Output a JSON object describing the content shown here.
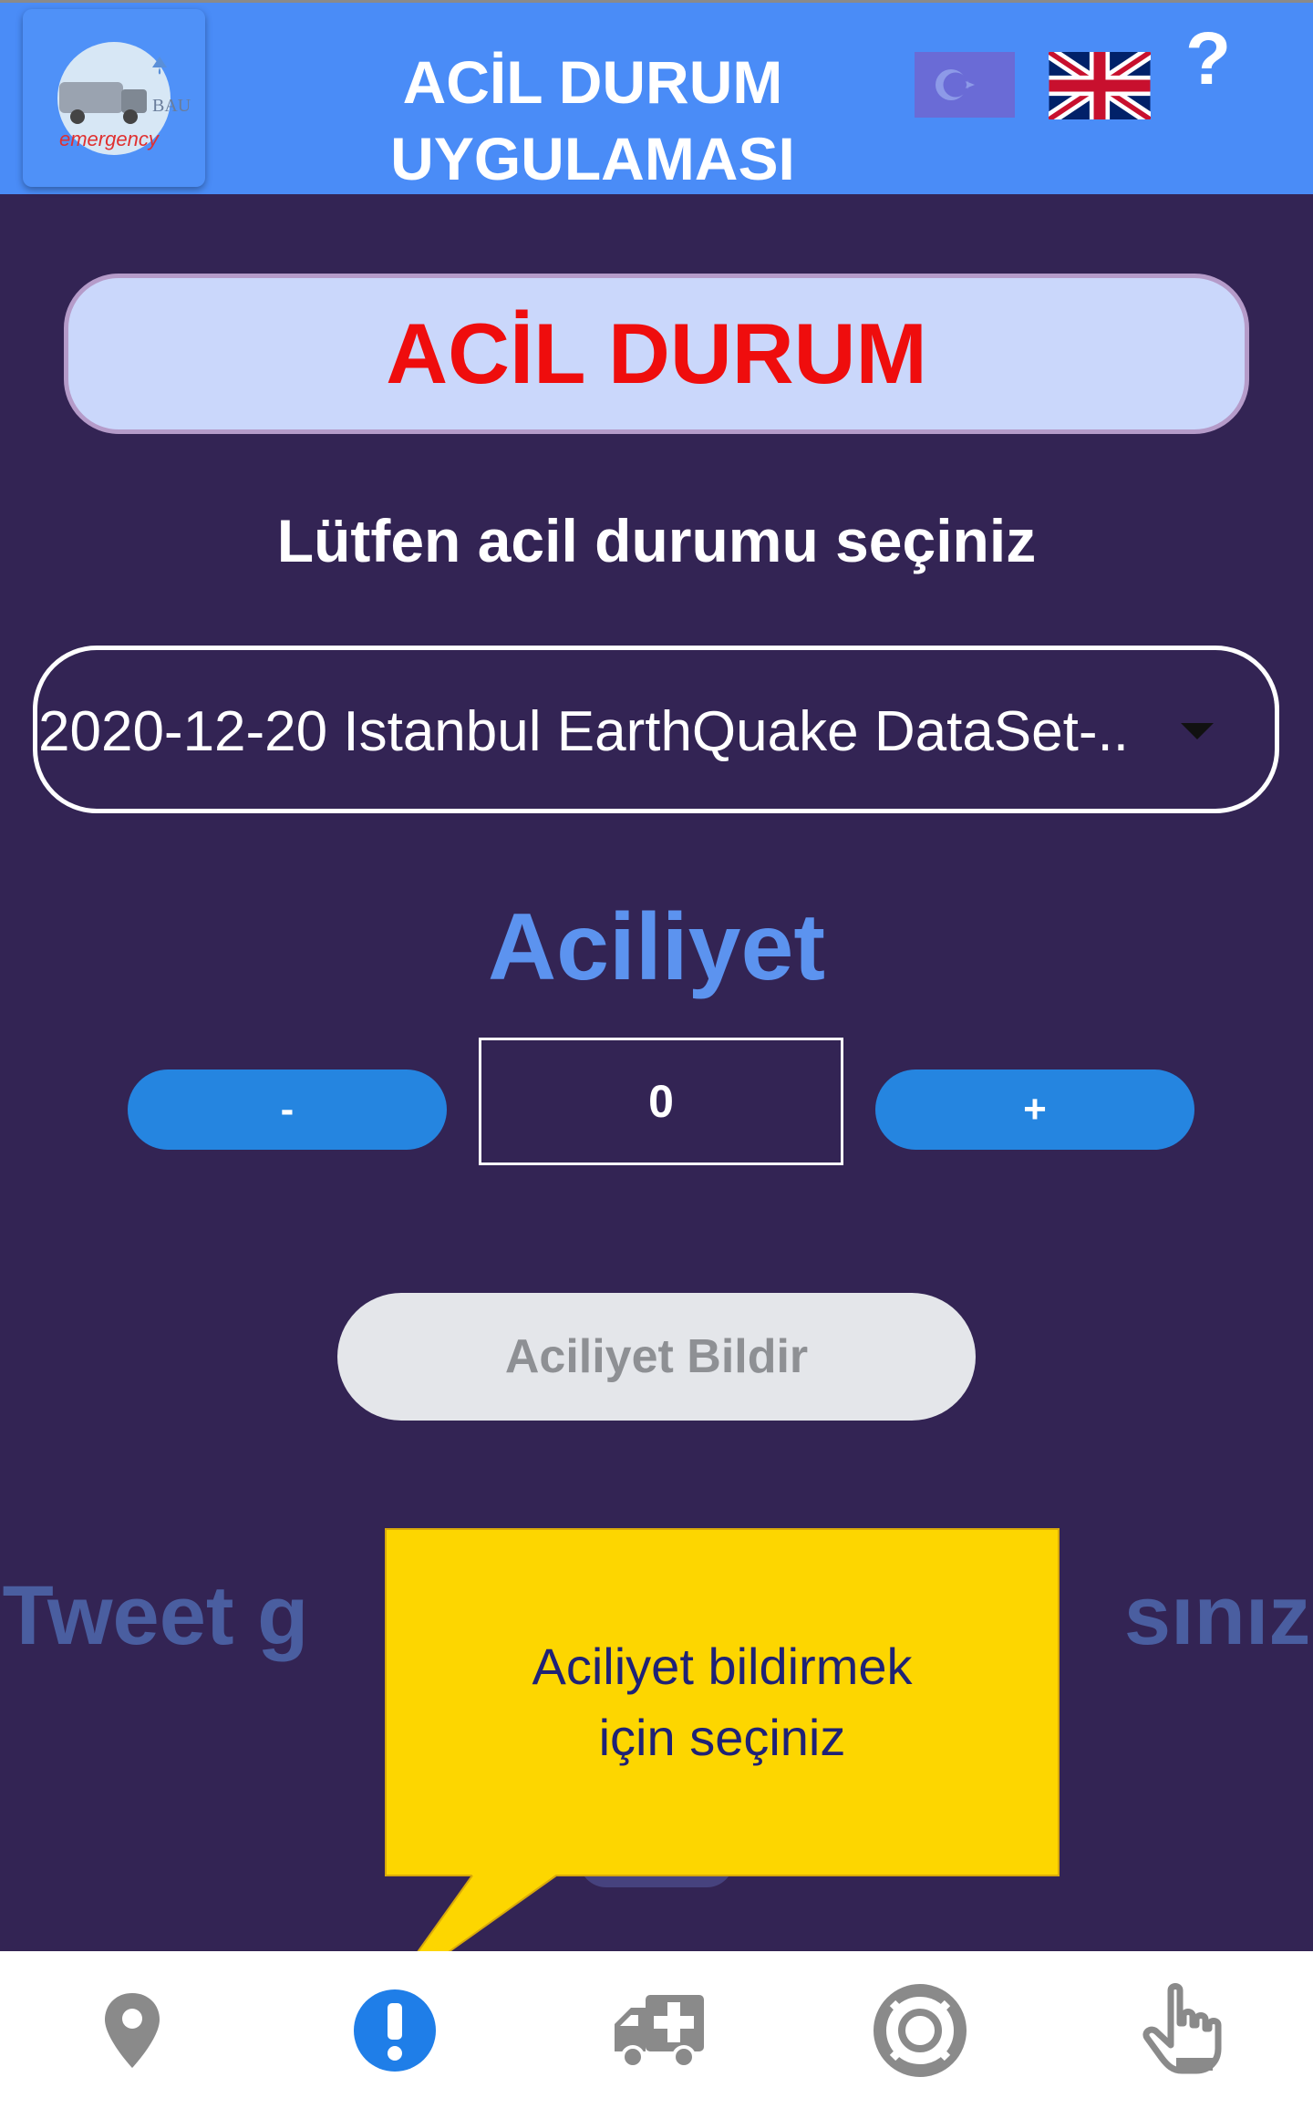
{
  "header": {
    "title_line1": "ACİL DURUM",
    "title_line2": "UYGULAMASI",
    "logo_text_small": "BAU",
    "logo_text": "emergency",
    "help_label": "?"
  },
  "main": {
    "emergency_button_label": "ACİL DURUM",
    "select_prompt": "Lütfen acil durumu seçiniz",
    "selected_dataset": "2020-12-20 Istanbul EarthQuake DataSet-..",
    "urgency_title": "Aciliyet",
    "decrement_label": "-",
    "urgency_value": "0",
    "increment_label": "+",
    "report_button_label": "Aciliyet Bildir",
    "tweet_text_visible": "Tweet g                                   sınız"
  },
  "callout": {
    "line1": "Aciliyet bildirmek",
    "line2": "için seçiniz"
  },
  "bottom_nav": {
    "items": [
      {
        "icon": "location-pin-icon"
      },
      {
        "icon": "exclamation-icon",
        "active": true
      },
      {
        "icon": "ambulance-icon"
      },
      {
        "icon": "lifebuoy-icon"
      },
      {
        "icon": "hand-pointer-icon"
      }
    ]
  },
  "colors": {
    "header_bg": "#4a8cf7",
    "page_bg": "#332454",
    "emergency_text": "#ef0d0d",
    "accent_button": "#2585e0",
    "callout_bg": "#fdd600",
    "nav_active": "#1f7ee8",
    "nav_inactive": "#8a8a8a"
  }
}
